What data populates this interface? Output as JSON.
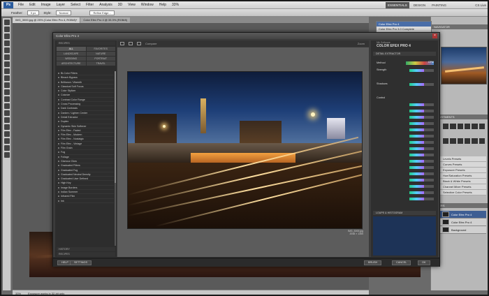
{
  "menubar": {
    "logo": "Ps",
    "items": [
      "File",
      "Edit",
      "Image",
      "Layer",
      "Select",
      "Filter",
      "Analysis",
      "3D",
      "View",
      "Window",
      "Help"
    ],
    "zoom": "33%",
    "workspaces": [
      "ESSENTIALS",
      "DESIGN",
      "PAINTING"
    ],
    "cs_live": "CS Live"
  },
  "options": {
    "feather_label": "Feather:",
    "feather_value": "0 px",
    "style_label": "Style:",
    "style_value": "Normal",
    "refine_edge": "Refine Edge..."
  },
  "doc_tabs": [
    "IMG_3000.jpg @ 25% (Color Efex Pro 4, RGB/8)*",
    "Color Efex Pro 4 @ 33.3% (RGB/8)"
  ],
  "bg_window": [
    "Color Efex Pro 4",
    "Color Efex Pro 3.0 Complete",
    "Color Efex Pro 3.0 Standard"
  ],
  "status_bar": {
    "zoom": "33%",
    "info": "Exposure works in 32-bit only"
  },
  "right_panels": {
    "navigator_label": "NAVIGATOR",
    "adjust_label": "ADJUSTMENTS",
    "presets": [
      "Levels Presets",
      "Curves Presets",
      "Exposure Presets",
      "Hue/Saturation Presets",
      "Black & White Presets",
      "Channel Mixer Presets",
      "Selective Color Presets"
    ],
    "layers_label": "LAYERS",
    "layers": [
      {
        "name": "Color Efex Pro 4",
        "selected": true
      },
      {
        "name": "Color Efex Pro 4",
        "selected": false
      },
      {
        "name": "Background",
        "selected": false
      }
    ]
  },
  "plugin": {
    "title": "Color Efex Pro 4",
    "close": "×",
    "categories": [
      {
        "label": "ALL",
        "on": true
      },
      {
        "label": "FAVORITES",
        "on": false
      },
      {
        "label": "LANDSCAPE",
        "on": false
      },
      {
        "label": "NATURE",
        "on": false
      },
      {
        "label": "WEDDING",
        "on": false
      },
      {
        "label": "PORTRAIT",
        "on": false
      },
      {
        "label": "ARCHITECTURE",
        "on": false
      },
      {
        "label": "TRAVEL",
        "on": false
      }
    ],
    "filter_header": "RECIPES",
    "filters": [
      "Bi-Color Filters",
      "Bleach Bypass",
      "Brilliance / Warmth",
      "Classical Soft Focus",
      "Color Stylizer",
      "Colorize",
      "Contrast Color Range",
      "Cross Processing",
      "Dark Contrasts",
      "Darken / Lighten Center",
      "Detail Extractor",
      "Duplex",
      "Dynamic Skin Softener",
      "Film Efex - Faded",
      "Film Efex - Modern",
      "Film Efex - Nostalgic",
      "Film Efex - Vintage",
      "Film Grain",
      "Fog",
      "Foliage",
      "Glamour Glow",
      "Graduated Filters",
      "Graduated Fog",
      "Graduated Neutral Density",
      "Graduated User Defined",
      "High Key",
      "Image Borders",
      "Indian Summer",
      "Infrared Film",
      "Ink"
    ],
    "history_label": "HISTORY",
    "recipes_label": "RECIPES",
    "toolbar": {
      "view": "Compare",
      "zoom_label": "Zoom"
    },
    "photo_caption": "IMG_3000.jpg",
    "photo_meta": "2048 × 1365",
    "right": {
      "brand_sub": "Nik Software",
      "brand": "COLOR EFEX PRO 4",
      "section1": "DETAIL EXTRACTOR",
      "method_label": "Method",
      "method_value": "CFM",
      "strength_label": "Strength",
      "shadows_label": "Shadows",
      "control_label": "Control",
      "loupe_section": "LOUPE & HISTOGRAM"
    },
    "bottom": {
      "help": "HELP",
      "settings": "SETTINGS",
      "brush": "BRUSH",
      "cancel": "CANCEL",
      "ok": "OK"
    }
  }
}
